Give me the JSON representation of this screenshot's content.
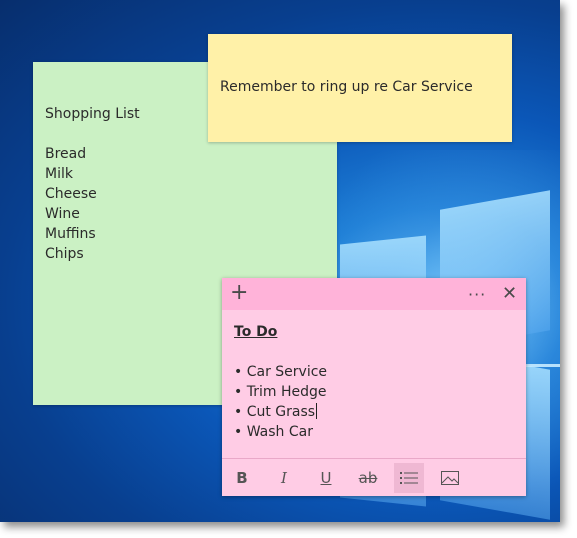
{
  "green_note": {
    "lines": [
      "Shopping List",
      "",
      "Bread",
      "Milk",
      "Cheese",
      "Wine",
      "Muffins",
      "Chips"
    ]
  },
  "yellow_note": {
    "text": "Remember to ring up re Car Service"
  },
  "pink_note": {
    "title": "To Do",
    "items": [
      "Car Service",
      "Trim Hedge",
      "Cut Grass",
      "Wash Car"
    ],
    "header_icons": {
      "add": "plus-icon",
      "more": "more-icon",
      "close": "close-icon"
    },
    "toolbar": {
      "bold": "B",
      "italic": "I",
      "underline": "U",
      "strikethrough": "ab",
      "bullets_icon": "bullet-list-icon",
      "image_icon": "image-icon"
    }
  },
  "colors": {
    "green_note": "#cbf1c4",
    "yellow_note": "#fff1a8",
    "pink_note": "#ffcce5",
    "pink_header": "#ffb3d9"
  }
}
